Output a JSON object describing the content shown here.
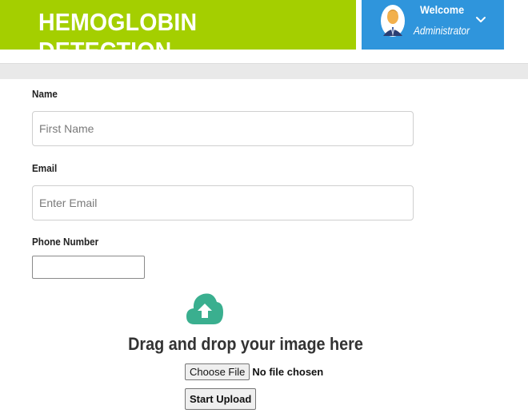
{
  "header": {
    "title": "HEMOGLOBIN DETECTION",
    "colors": {
      "banner": "#a4cf00",
      "user_panel": "#2f95dc"
    }
  },
  "user": {
    "welcome": "Welcome",
    "role": "Administrator",
    "avatar_icon": "user-avatar-icon",
    "menu_icon": "chevron-down-icon"
  },
  "form": {
    "name_label": "Name",
    "name_placeholder": "First Name",
    "email_label": "Email",
    "email_placeholder": "Enter Email",
    "phone_label": "Phone Number",
    "phone_value": ""
  },
  "upload": {
    "icon": "cloud-upload-icon",
    "icon_color": "#3aaf8f",
    "drop_text": "Drag and drop your image here",
    "choose_label": "Choose File",
    "file_status": "No file chosen",
    "start_label": "Start Upload"
  }
}
